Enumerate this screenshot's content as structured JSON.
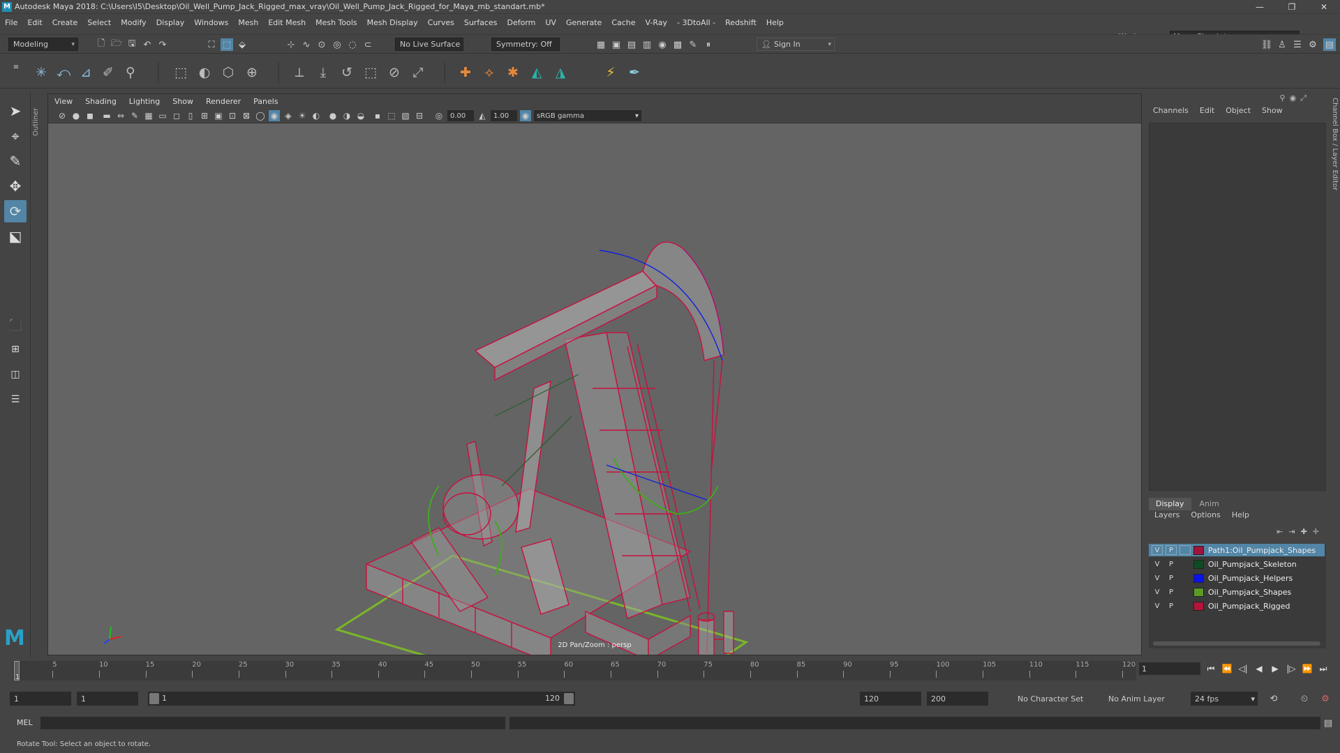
{
  "window": {
    "title": "Autodesk Maya 2018: C:\\Users\\I5\\Desktop\\Oil_Well_Pump_Jack_Rigged_max_vray\\Oil_Well_Pump_Jack_Rigged_for_Maya_mb_standart.mb*",
    "app_icon": "M"
  },
  "menubar": {
    "items": [
      "File",
      "Edit",
      "Create",
      "Select",
      "Modify",
      "Display",
      "Windows",
      "Mesh",
      "Edit Mesh",
      "Mesh Tools",
      "Mesh Display",
      "Curves",
      "Surfaces",
      "Deform",
      "UV",
      "Generate",
      "Cache",
      "V-Ray",
      "- 3DtoAll -",
      "Redshift",
      "Help"
    ],
    "workspace_label": "Workspace :",
    "workspace_value": "Maya Classic*"
  },
  "statusline": {
    "mode": "Modeling",
    "live_surface": "No Live Surface",
    "symmetry": "Symmetry: Off",
    "sign_in": "Sign In"
  },
  "viewport": {
    "menu": [
      "View",
      "Shading",
      "Lighting",
      "Show",
      "Renderer",
      "Panels"
    ],
    "exposure": "0.00",
    "gamma": "1.00",
    "color_space": "sRGB gamma",
    "camera_label": "2D Pan/Zoom : persp"
  },
  "outliner_tab": "Outliner",
  "channel_box": {
    "menu": [
      "Channels",
      "Edit",
      "Object",
      "Show"
    ],
    "side_tab": "Channel Box / Layer Editor"
  },
  "layer_editor": {
    "tabs": [
      "Display",
      "Anim"
    ],
    "menu": [
      "Layers",
      "Options",
      "Help"
    ],
    "layers": [
      {
        "v": "V",
        "p": "P",
        "color": "#a0143c",
        "name": "Path1:Oil_Pumpjack_Shapes",
        "selected": true
      },
      {
        "v": "V",
        "p": "P",
        "color": "#0f4a23",
        "name": "Oil_Pumpjack_Skeleton",
        "selected": false
      },
      {
        "v": "V",
        "p": "P",
        "color": "#0a14e6",
        "name": "Oil_Pumpjack_Helpers",
        "selected": false
      },
      {
        "v": "V",
        "p": "P",
        "color": "#5a9a28",
        "name": "Oil_Pumpjack_Shapes",
        "selected": false
      },
      {
        "v": "V",
        "p": "P",
        "color": "#b4143c",
        "name": "Oil_Pumpjack_Rigged",
        "selected": false
      }
    ]
  },
  "timeline": {
    "ticks": [
      "5",
      "10",
      "15",
      "20",
      "25",
      "30",
      "35",
      "40",
      "45",
      "50",
      "55",
      "60",
      "65",
      "70",
      "75",
      "80",
      "85",
      "90",
      "95",
      "100",
      "105",
      "110",
      "115",
      "120"
    ],
    "current_frame": "1",
    "current_marker": "1"
  },
  "range": {
    "start": "1",
    "playback_start": "1",
    "slider_start": "1",
    "slider_end": "120",
    "playback_end": "120",
    "end": "200",
    "character_set": "No Character Set",
    "anim_layer": "No Anim Layer",
    "fps": "24 fps"
  },
  "command": {
    "label": "MEL"
  },
  "help_line": "Rotate Tool: Select an object to rotate.",
  "colors": {
    "wire": "#c8103e",
    "grid_green": "#7ab62a",
    "selection_blue": "#5285a6"
  }
}
